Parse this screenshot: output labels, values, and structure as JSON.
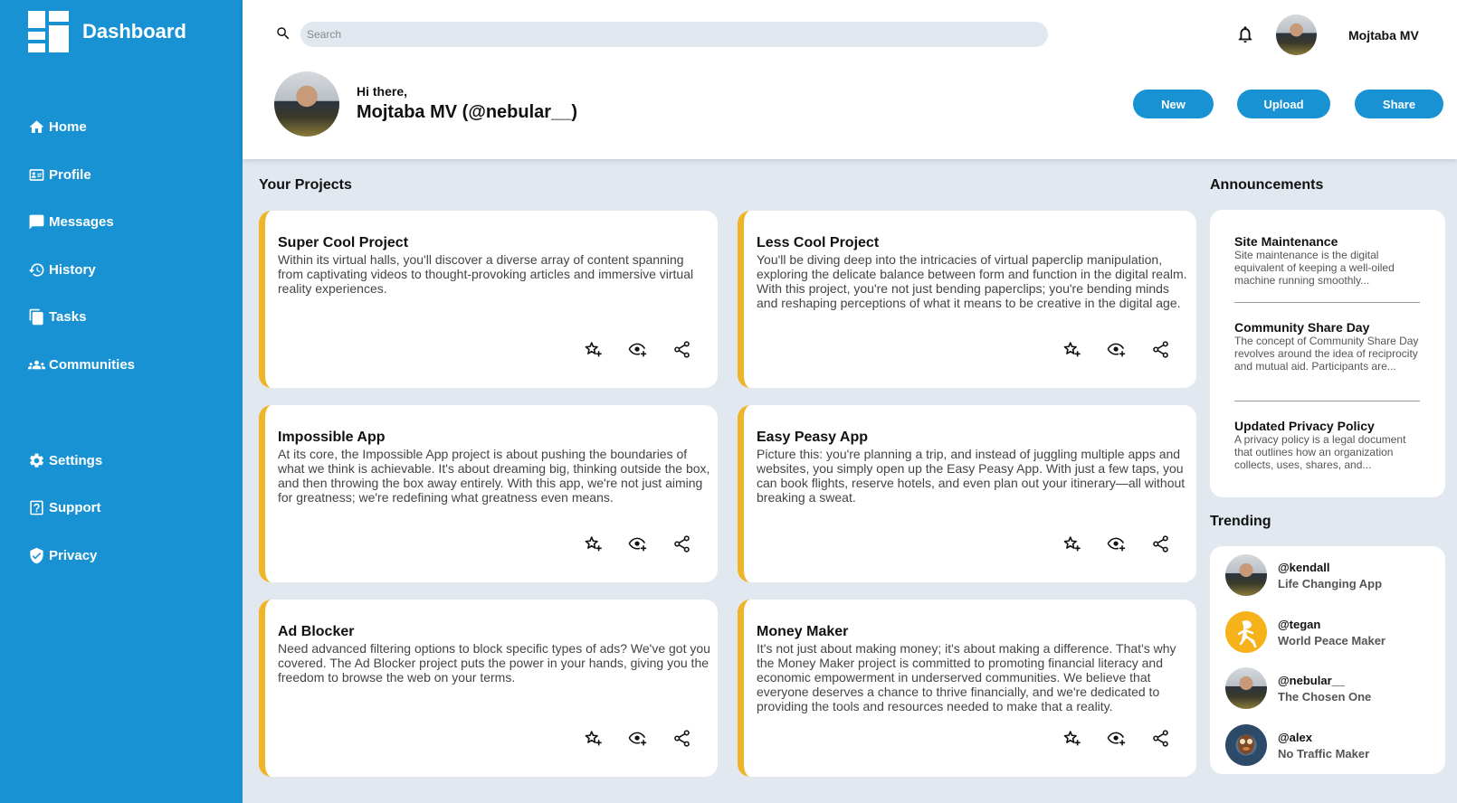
{
  "sidebar": {
    "brand": "Dashboard",
    "nav": [
      {
        "label": "Home",
        "icon": "home-icon"
      },
      {
        "label": "Profile",
        "icon": "profile-card-icon"
      },
      {
        "label": "Messages",
        "icon": "message-icon"
      },
      {
        "label": "History",
        "icon": "history-icon"
      },
      {
        "label": "Tasks",
        "icon": "file-icon"
      },
      {
        "label": "Communities",
        "icon": "people-icon"
      },
      {
        "label": "Settings",
        "icon": "gear-icon"
      },
      {
        "label": "Support",
        "icon": "help-icon"
      },
      {
        "label": "Privacy",
        "icon": "shield-icon"
      }
    ]
  },
  "header": {
    "search_placeholder": "Search",
    "user_name": "Mojtaba MV",
    "greeting": "Hi there,",
    "greeting_name": "Mojtaba MV (@nebular__)",
    "buttons": {
      "new": "New",
      "upload": "Upload",
      "share": "Share"
    }
  },
  "projects": {
    "title": "Your Projects",
    "items": [
      {
        "title": "Super Cool Project",
        "desc": "Within its virtual halls, you'll discover a diverse array of content spanning from captivating videos to thought-provoking articles and immersive virtual reality experiences."
      },
      {
        "title": "Less Cool Project",
        "desc": "You'll be diving deep into the intricacies of virtual paperclip manipulation, exploring the delicate balance between form and function in the digital realm. With this project, you're not just bending paperclips; you're bending minds and reshaping perceptions of what it means to be creative in the digital age."
      },
      {
        "title": "Impossible App",
        "desc": "At its core, the Impossible App project is about pushing the boundaries of what we think is achievable. It's about dreaming big, thinking outside the box, and then throwing the box away entirely. With this app, we're not just aiming for greatness; we're redefining what greatness even means."
      },
      {
        "title": "Easy Peasy App",
        "desc": "Picture this: you're planning a trip, and instead of juggling multiple apps and websites, you simply open up the Easy Peasy App. With just a few taps, you can book flights, reserve hotels, and even plan out your itinerary—all without breaking a sweat."
      },
      {
        "title": "Ad Blocker",
        "desc": "Need advanced filtering options to block specific types of ads? We've got you covered. The Ad Blocker project puts the power in your hands, giving you the freedom to browse the web on your terms."
      },
      {
        "title": "Money Maker",
        "desc": "It's not just about making money; it's about making a difference. That's why the Money Maker project is committed to promoting financial literacy and economic empowerment in underserved communities. We believe that everyone deserves a chance to thrive financially, and we're dedicated to providing the tools and resources needed to make that a reality."
      }
    ]
  },
  "announcements": {
    "title": "Announcements",
    "items": [
      {
        "title": "Site Maintenance",
        "text": "Site maintenance is the digital equivalent of keeping a well-oiled machine running smoothly..."
      },
      {
        "title": "Community Share Day",
        "text": "The concept of Community Share Day revolves around the idea of reciprocity and mutual aid. Participants are..."
      },
      {
        "title": "Updated Privacy Policy",
        "text": "A privacy policy is a legal document that outlines how an organization collects, uses, shares, and..."
      }
    ]
  },
  "trending": {
    "title": "Trending",
    "items": [
      {
        "handle": "@kendall",
        "project": "Life Changing App"
      },
      {
        "handle": "@tegan",
        "project": "World Peace Maker"
      },
      {
        "handle": "@nebular__",
        "project": "The Chosen One"
      },
      {
        "handle": "@alex",
        "project": "No Traffic Maker"
      }
    ]
  },
  "colors": {
    "sidebar": "#1992d4",
    "accent": "#f0b429",
    "background": "#e2e8f0"
  }
}
